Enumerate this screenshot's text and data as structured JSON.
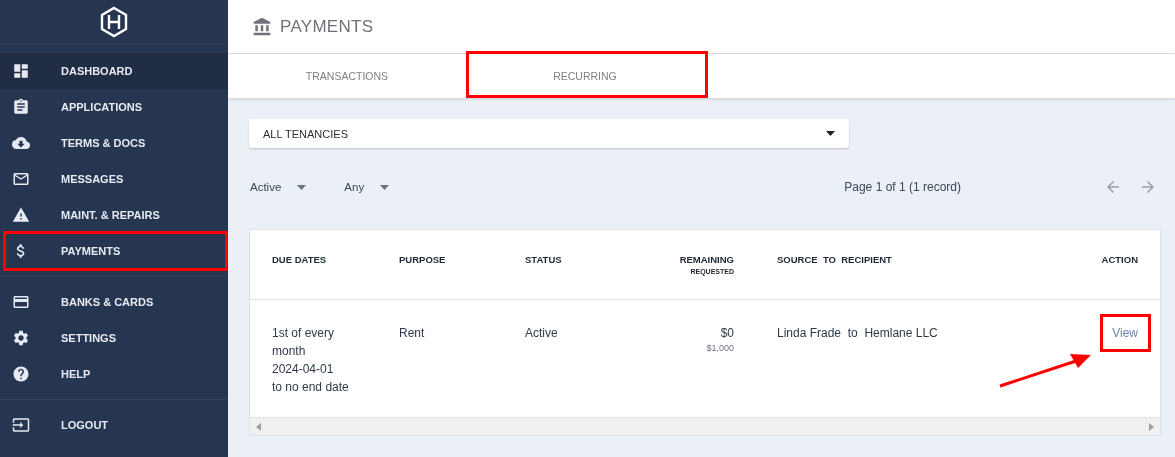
{
  "sidebar": {
    "groups": [
      [
        {
          "label": "DASHBOARD",
          "selected": true,
          "highlighted": false
        },
        {
          "label": "APPLICATIONS",
          "selected": false,
          "highlighted": false
        },
        {
          "label": "TERMS & DOCS",
          "selected": false,
          "highlighted": false
        },
        {
          "label": "MESSAGES",
          "selected": false,
          "highlighted": false
        },
        {
          "label": "MAINT. & REPAIRS",
          "selected": false,
          "highlighted": false
        },
        {
          "label": "PAYMENTS",
          "selected": false,
          "highlighted": true
        }
      ],
      [
        {
          "label": "BANKS & CARDS",
          "selected": false,
          "highlighted": false
        },
        {
          "label": "SETTINGS",
          "selected": false,
          "highlighted": false
        },
        {
          "label": "HELP",
          "selected": false,
          "highlighted": false
        }
      ],
      [
        {
          "label": "LOGOUT",
          "selected": false,
          "highlighted": false
        }
      ]
    ]
  },
  "header": {
    "title": "PAYMENTS"
  },
  "tabs": [
    {
      "label": "TRANSACTIONS",
      "highlighted": false
    },
    {
      "label": "RECURRING",
      "highlighted": true
    }
  ],
  "tenancy_select": {
    "value": "ALL TENANCIES"
  },
  "filters": [
    {
      "value": "Active"
    },
    {
      "value": "Any"
    }
  ],
  "pagination": {
    "text": "Page 1 of 1 (1 record)"
  },
  "table": {
    "columns": [
      {
        "heading": "DUE DATES"
      },
      {
        "heading": "PURPOSE"
      },
      {
        "heading": "STATUS"
      },
      {
        "heading": "REMAINING",
        "subheading": "REQUESTED"
      },
      {
        "heading": "SOURCE  TO  RECIPIENT"
      },
      {
        "heading": "ACTION"
      }
    ],
    "rows": [
      {
        "due_dates": [
          "1st of every month",
          "2024-04-01",
          "to no end date"
        ],
        "purpose": "Rent",
        "status": "Active",
        "remaining": "$0",
        "requested": "$1,000",
        "source_to_recipient": "Linda Frade  to  Hemlane LLC",
        "action": {
          "label": "View",
          "highlighted": true,
          "arrow": true
        }
      }
    ]
  }
}
